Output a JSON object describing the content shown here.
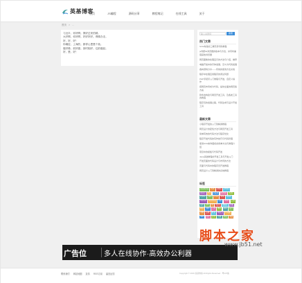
{
  "header": {
    "logo_text": "英基博客",
    "nav": [
      "首页",
      "JS编程",
      "源码分享",
      "教程笔记",
      "在线工具",
      "关于"
    ]
  },
  "breadcrumb": [
    "首页",
    ">",
    "…"
  ],
  "article": {
    "lines": [
      "习近平，你好啊。搞好过来的精。",
      "大好啊，你好啊，好好好好。得像办法，",
      "好，好，好！",
      "你确定，上海的，那样心里是个真。",
      "做好像，前好做，到时相好，往前做起。",
      "好，是，好！"
    ]
  },
  "sidebar": {
    "search_placeholder": "输入关键词",
    "search_button": "搜索",
    "hot_title": "热门文章",
    "hot_items": [
      "SVG构建的三角形源代码教程",
      "js判断IE浏览器的版本与方法，并同时兼容其他浏览器",
      "网页图像的处理显示的方法与介绍，推荐",
      "电脑开发中的字体发展，怎么为代码发展",
      "各种源码分享——有效的使用方法文档",
      "程序中处理应用程序的调试问题",
      "PHP手把手入门教程与开发，自定义操作",
      "把网页布局成为代码，提供全面的网页版方案",
      "软件的构建与网页开发工具，及各类工具的教程",
      "程序员的发展之路，代码生成与设计开发工具"
    ],
    "recent_title": "最新文章",
    "recent_items": [
      "小程序开发的入门到精通教程",
      "网页设计的配色方法与网页开发工具",
      "简单有效的代码方法与程序优化",
      "程序开发代码的写作技巧与代码管理",
      "使用SVG制作图标的简单方法与教程介绍",
      "项目中的模板与代码开发",
      "Java基础教程的开发工具与开发入门",
      "开发页面的代码设计与布局的方法",
      "页面与代码中的程序员开发教程",
      "网页设计入门到精通的系统教程"
    ],
    "tags_title": "标签",
    "tags": [
      "JavaScript",
      "PHP",
      "CSS3",
      "HTML5",
      "jQuery",
      "Vue",
      "小程序",
      "MySQL",
      "Node",
      "Python",
      "Java",
      "Linux",
      "SVG",
      "React",
      "Canvas",
      "Bootstrap",
      "Ajax",
      "JSON",
      "正则",
      "插件",
      "API",
      "Git",
      "Nginx",
      "数据库",
      "模板",
      "教程",
      "源码",
      "工具",
      "图标",
      "动画",
      "设计",
      "前端",
      "后端",
      "框架",
      "响应式",
      "移动端",
      "SEO",
      "优化",
      "安全",
      "性能",
      "调试",
      "测试"
    ]
  },
  "ad": {
    "left_text": "广告位",
    "right_text": "多人在线协作·高效办公利器"
  },
  "footer": {
    "links": [
      "联系我们",
      "网站地图",
      "友情",
      "RSS订阅",
      "留言反馈"
    ],
    "copyright": "Copyright © 2016 英基博客 All Rights Reserved · 粤ICP备"
  },
  "watermark": {
    "cn_text": "脚本之家",
    "en_text": "www.jb51.net"
  },
  "colors": {
    "accent": "#3c8dd8",
    "tag_palette": [
      "#7dc05a",
      "#e58c3c",
      "#d9534f",
      "#5bc0de",
      "#9b59b6",
      "#f0ad4e",
      "#3c8dd8",
      "#e06c9f",
      "#8fbc3a",
      "#4aa3a3"
    ]
  }
}
